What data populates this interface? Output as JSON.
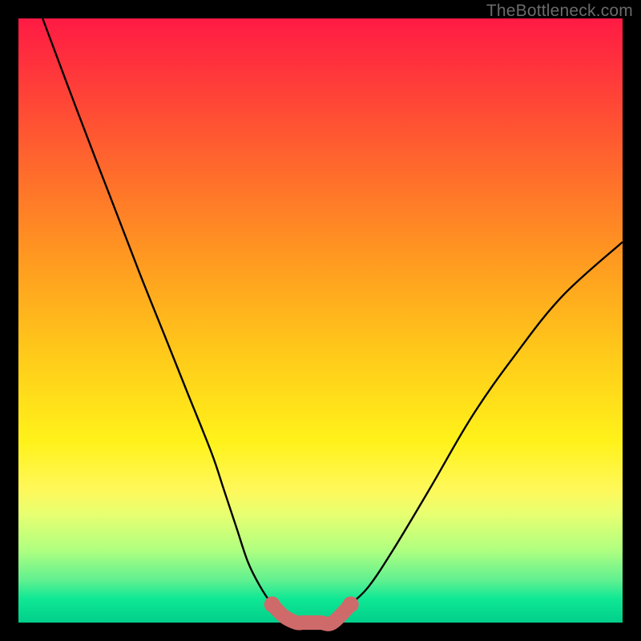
{
  "watermark": "TheBottleneck.com",
  "chart_data": {
    "type": "line",
    "title": "",
    "xlabel": "",
    "ylabel": "",
    "xlim": [
      0,
      100
    ],
    "ylim": [
      0,
      100
    ],
    "series": [
      {
        "name": "curve",
        "x": [
          4,
          10,
          15,
          20,
          24,
          28,
          32,
          34,
          36,
          38,
          40,
          42,
          44,
          46,
          47,
          52,
          55,
          58,
          62,
          68,
          75,
          82,
          90,
          100
        ],
        "values": [
          100,
          84,
          71,
          58,
          48,
          38,
          28,
          22,
          16,
          10,
          6,
          3,
          1,
          0,
          0,
          0,
          3,
          6,
          12,
          22,
          34,
          44,
          54,
          63
        ]
      }
    ],
    "highlight": {
      "name": "trough-band",
      "x": [
        42,
        44,
        46,
        47,
        48,
        50,
        52,
        55
      ],
      "values": [
        3,
        1,
        0,
        0,
        0,
        0,
        0,
        3
      ]
    }
  }
}
